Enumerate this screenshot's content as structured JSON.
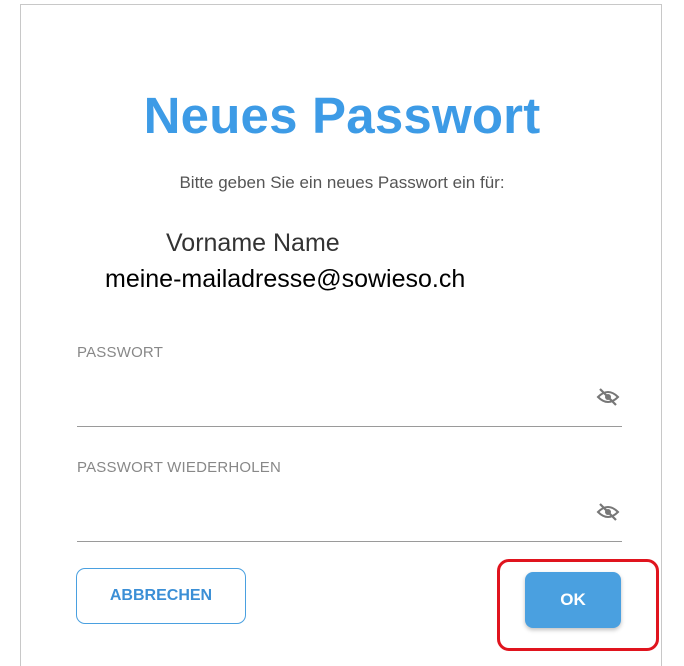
{
  "dialog": {
    "title": "Neues Passwort",
    "subtitle": "Bitte geben Sie ein neues Passwort ein für:",
    "user_name": "Vorname Name",
    "user_email": "meine-mailadresse@sowieso.ch"
  },
  "fields": {
    "password": {
      "label": "PASSWORT",
      "value": "",
      "icon": "eye-off-icon"
    },
    "password_repeat": {
      "label": "PASSWORT WIEDERHOLEN",
      "value": "",
      "icon": "eye-off-icon"
    }
  },
  "buttons": {
    "cancel_label": "ABBRECHEN",
    "ok_label": "OK"
  },
  "colors": {
    "accent": "#3d9be6",
    "highlight": "#e0141e"
  }
}
